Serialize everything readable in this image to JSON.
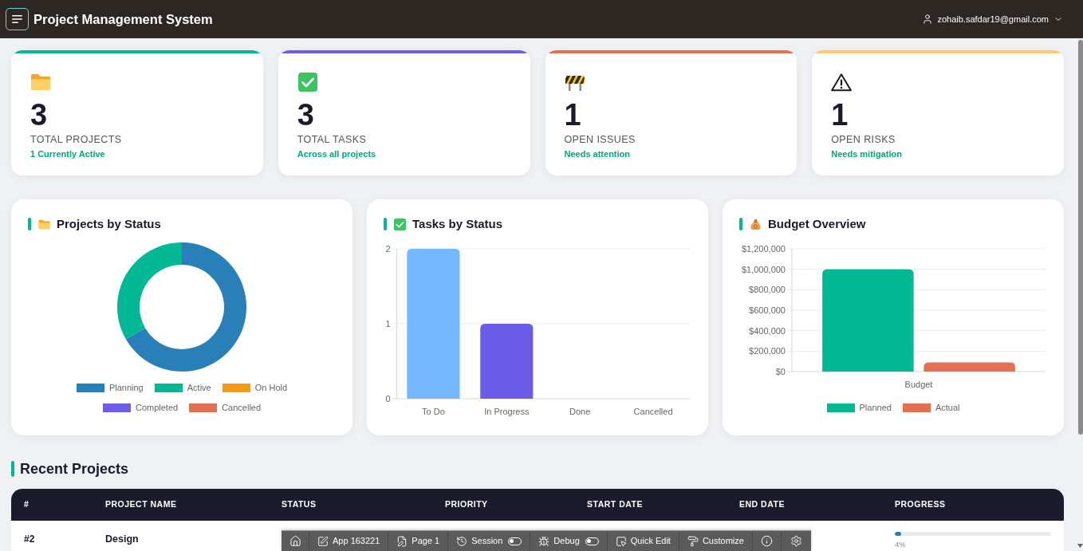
{
  "header": {
    "title": "Project Management System",
    "user_email": "zohaib.safdar19@gmail.com"
  },
  "stat_cards": [
    {
      "value": "3",
      "label": "TOTAL PROJECTS",
      "note": "1 Currently Active",
      "color": "#00b894"
    },
    {
      "value": "3",
      "label": "TOTAL TASKS",
      "note": "Across all projects",
      "color": "#6c5ce7"
    },
    {
      "value": "1",
      "label": "OPEN ISSUES",
      "note": "Needs attention",
      "color": "#e17055"
    },
    {
      "value": "1",
      "label": "OPEN RISKS",
      "note": "Needs mitigation",
      "color": "#fdcb6e"
    }
  ],
  "charts": [
    {
      "title": "Projects by Status",
      "chart_data": {
        "type": "donut",
        "categories": [
          "Planning",
          "Active",
          "On Hold",
          "Completed",
          "Cancelled"
        ],
        "values": [
          66.7,
          33.3,
          0,
          0,
          0
        ],
        "colors": [
          "#2980b9",
          "#00b894",
          "#f39c12",
          "#6c5ce7",
          "#e17055"
        ],
        "legend": "bottom"
      }
    },
    {
      "title": "Tasks by Status",
      "chart_data": {
        "type": "bar",
        "categories": [
          "To Do",
          "In Progress",
          "Done",
          "Cancelled"
        ],
        "values": [
          2,
          1,
          0,
          0
        ],
        "colors": [
          "#74b9ff",
          "#6c5ce7",
          null,
          null
        ],
        "ylim": [
          0,
          2
        ],
        "yticks": [
          0,
          1,
          2
        ],
        "grid": true
      }
    },
    {
      "title": "Budget Overview",
      "chart_data": {
        "type": "bar",
        "categories": [
          "Budget"
        ],
        "series": [
          {
            "name": "Planned",
            "color": "#00b894",
            "values": [
              1000000
            ]
          },
          {
            "name": "Actual",
            "color": "#e17055",
            "values": [
              90000
            ]
          }
        ],
        "ylim": [
          0,
          1200000
        ],
        "yticks": [
          {
            "value": 0,
            "label": "$0"
          },
          {
            "value": 200000,
            "label": "$200,000"
          },
          {
            "value": 400000,
            "label": "$400,000"
          },
          {
            "value": 600000,
            "label": "$600,000"
          },
          {
            "value": 800000,
            "label": "$800,000"
          },
          {
            "value": 1000000,
            "label": "$1,000,000"
          },
          {
            "value": 1200000,
            "label": "$1,200,000"
          }
        ],
        "grid": true,
        "legend": "bottom"
      }
    }
  ],
  "recent_projects": {
    "title": "Recent Projects",
    "columns": [
      "#",
      "PROJECT NAME",
      "STATUS",
      "PRIORITY",
      "START DATE",
      "END DATE",
      "PROGRESS"
    ],
    "rows": [
      {
        "number": "#2",
        "name": "Design",
        "progress": {
          "level": 0.04,
          "reading": "4%"
        }
      }
    ]
  },
  "dev_toolbar": {
    "items": [
      {
        "kind": "link",
        "label": "App 163221"
      },
      {
        "kind": "link",
        "label": "Page 1"
      },
      {
        "kind": "toggle",
        "label": "Session",
        "on": false
      },
      {
        "kind": "toggle",
        "label": "Debug",
        "on": false
      },
      {
        "kind": "link",
        "label": "Quick Edit"
      },
      {
        "kind": "link",
        "label": "Customize"
      }
    ]
  }
}
